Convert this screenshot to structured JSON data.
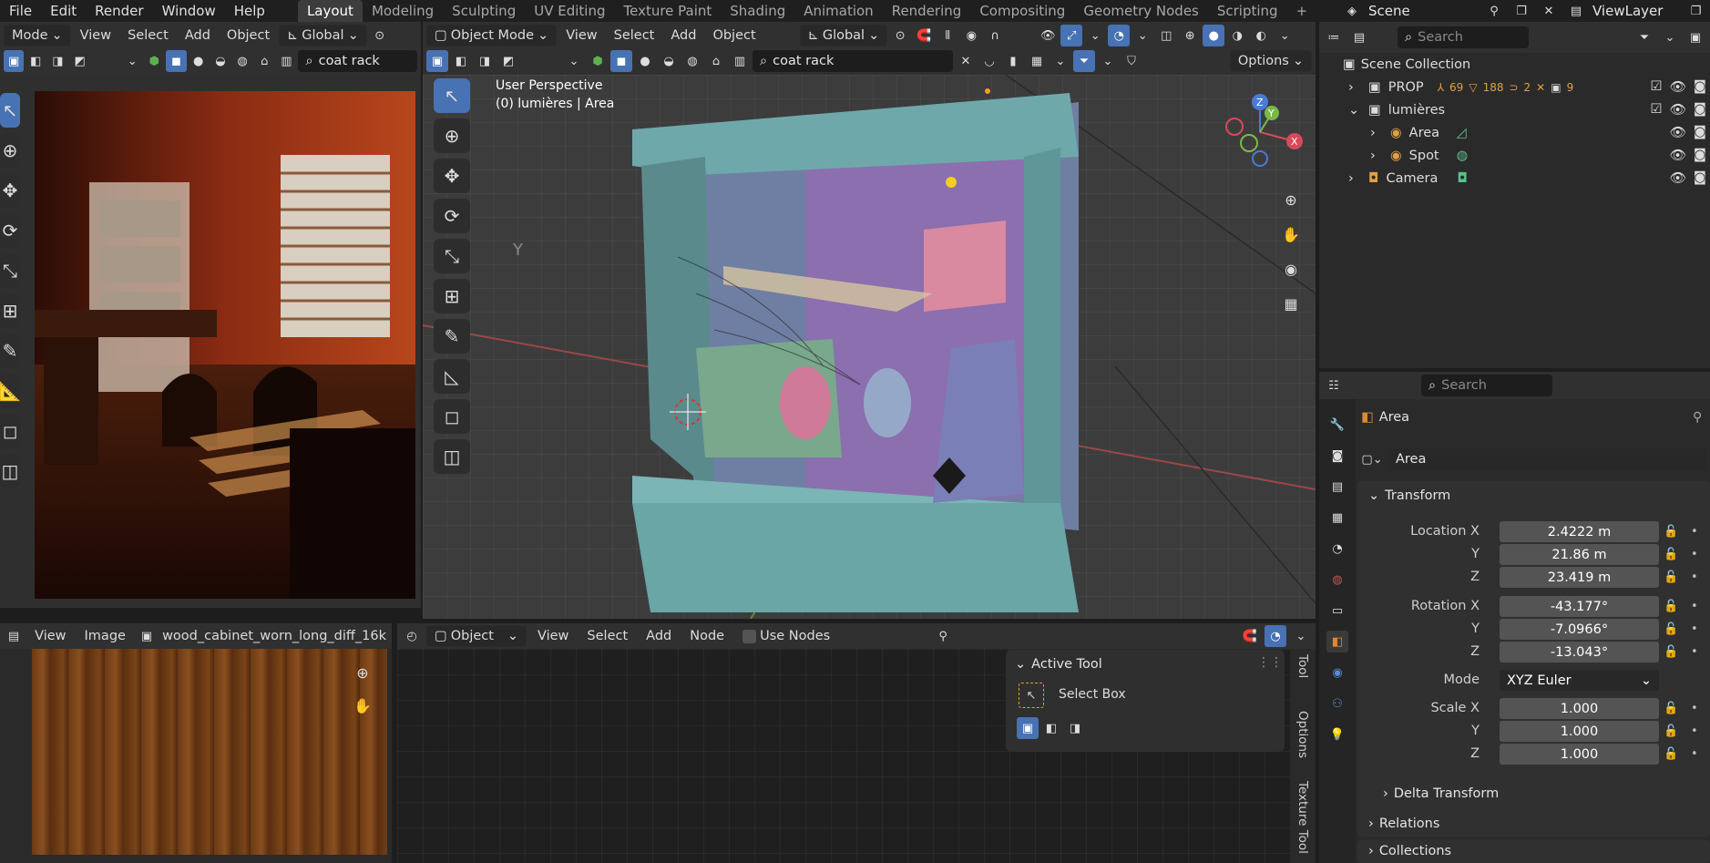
{
  "menu": [
    "File",
    "Edit",
    "Render",
    "Window",
    "Help"
  ],
  "workspaces": [
    "Layout",
    "Modeling",
    "Sculpting",
    "UV Editing",
    "Texture Paint",
    "Shading",
    "Animation",
    "Rendering",
    "Compositing",
    "Geometry Nodes",
    "Scripting"
  ],
  "active_workspace": "Layout",
  "add_tab": "+",
  "scene": {
    "name": "Scene",
    "view_layer": "ViewLayer"
  },
  "left_editor": {
    "mode": "Mode",
    "view": "View",
    "select": "Select",
    "add": "Add",
    "object": "Object",
    "orientation": "Global",
    "search": "coat rack"
  },
  "viewport": {
    "mode": "Object Mode",
    "view": "View",
    "select": "Select",
    "add": "Add",
    "object": "Object",
    "orientation": "Global",
    "search": "coat rack",
    "options": "Options",
    "perspective": "User Perspective",
    "context": "(0) lumières | Area",
    "axis_label": "Y"
  },
  "gizmo": {
    "z": "Z",
    "y": "Y",
    "x": "X"
  },
  "image_editor": {
    "view": "View",
    "image": "Image",
    "file": "wood_cabinet_worn_long_diff_16k"
  },
  "node_editor": {
    "object": "Object",
    "view": "View",
    "select": "Select",
    "add": "Add",
    "node": "Node",
    "use_nodes": "Use Nodes"
  },
  "active_tool": {
    "title": "Active Tool",
    "tool": "Select Box"
  },
  "side_tabs": [
    "Tool",
    "Options",
    "Texture Tool"
  ],
  "outliner": {
    "search": "Search",
    "root": "Scene Collection",
    "rows": [
      {
        "label": "PROP",
        "counts": [
          "69",
          "188",
          "2",
          "9"
        ]
      },
      {
        "label": "lumières"
      },
      {
        "label": "Area"
      },
      {
        "label": "Spot"
      },
      {
        "label": "Camera"
      }
    ]
  },
  "properties": {
    "search": "Search",
    "object_name": "Area",
    "datablock": "Area",
    "transform": "Transform",
    "location_x_label": "Location X",
    "location_x": "2.4222 m",
    "location_y_label": "Y",
    "location_y": "21.86 m",
    "location_z_label": "Z",
    "location_z": "23.419 m",
    "rotation_x_label": "Rotation X",
    "rotation_x": "-43.177°",
    "rotation_y_label": "Y",
    "rotation_y": "-7.0966°",
    "rotation_z_label": "Z",
    "rotation_z": "-13.043°",
    "mode_label": "Mode",
    "mode": "XYZ Euler",
    "scale_x_label": "Scale X",
    "scale_x": "1.000",
    "scale_y_label": "Y",
    "scale_y": "1.000",
    "scale_z_label": "Z",
    "scale_z": "1.000",
    "delta": "Delta Transform",
    "relations": "Relations",
    "collections": "Collections"
  }
}
